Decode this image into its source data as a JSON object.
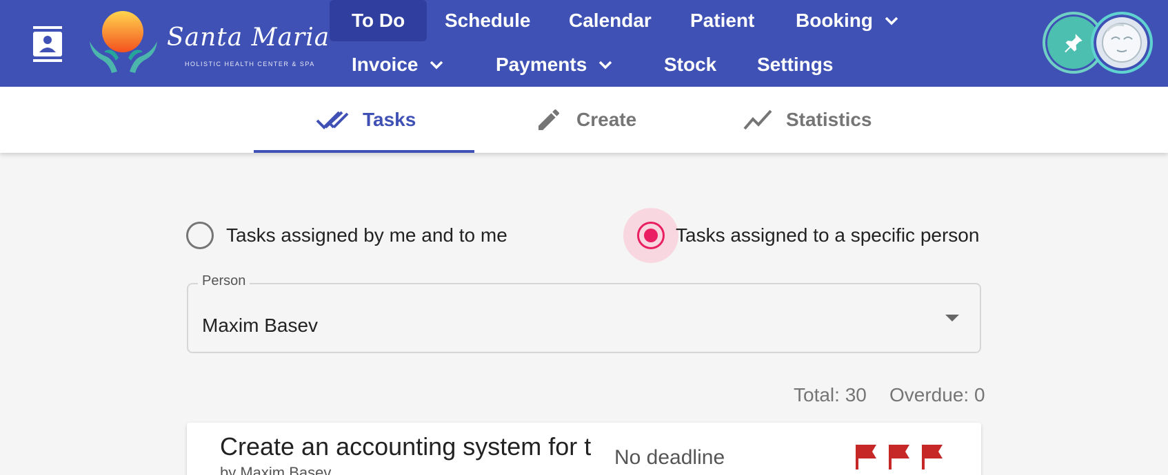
{
  "colors": {
    "primary": "#3f51b5",
    "primary_dark": "#303f9f",
    "accent": "#e91e63",
    "flag": "#c62828"
  },
  "brand": {
    "name": "Santa Maria",
    "tagline": "HOLISTIC HEALTH CENTER & SPA"
  },
  "nav": {
    "todo": "To Do",
    "schedule": "Schedule",
    "calendar": "Calendar",
    "patient": "Patient",
    "booking": "Booking",
    "invoice": "Invoice",
    "payments": "Payments",
    "stock": "Stock",
    "settings": "Settings"
  },
  "tabs": {
    "tasks": "Tasks",
    "create": "Create",
    "statistics": "Statistics",
    "active": "Tasks"
  },
  "filter": {
    "option_mine": "Tasks assigned by me and to me",
    "option_person": "Tasks assigned to a specific person",
    "selected": "Tasks assigned to a specific person"
  },
  "person_select": {
    "label": "Person",
    "value": "Maxim Basev"
  },
  "summary": {
    "total": "Total: 30",
    "overdue": "Overdue: 0"
  },
  "tasks": [
    {
      "title": "Create an accounting system for th",
      "by": "by Maxim Basev",
      "deadline": "No deadline",
      "flags": 3
    }
  ]
}
